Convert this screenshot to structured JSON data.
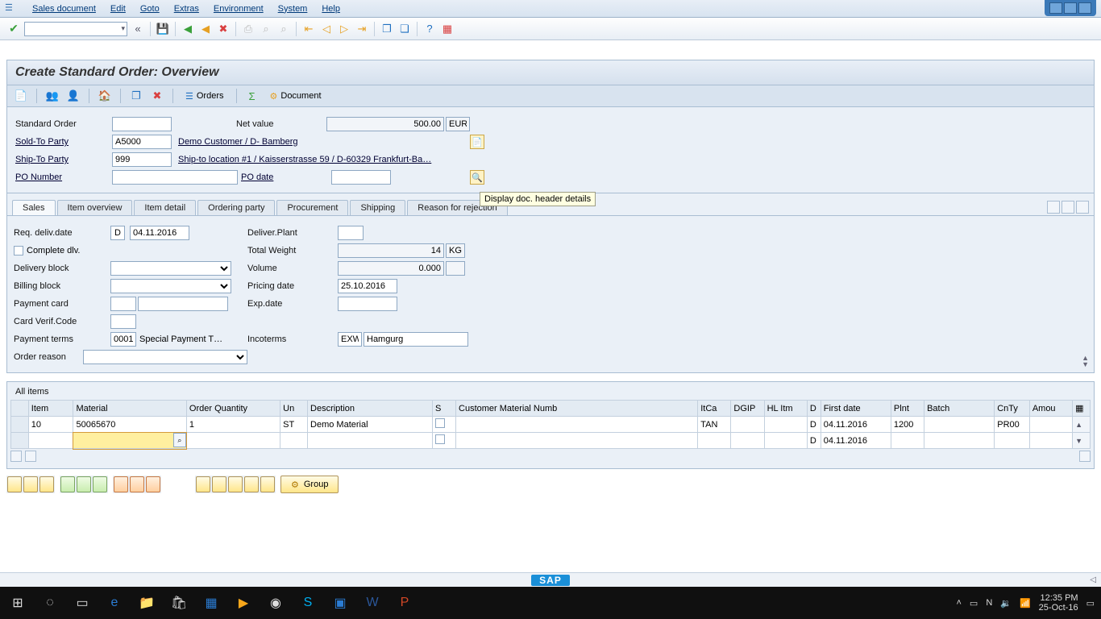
{
  "menubar": {
    "items": [
      "Sales document",
      "Edit",
      "Goto",
      "Extras",
      "Environment",
      "System",
      "Help"
    ]
  },
  "page_title": "Create Standard Order: Overview",
  "app_toolbar": {
    "orders_label": "Orders",
    "document_label": "Document"
  },
  "header": {
    "standard_order_label": "Standard Order",
    "standard_order": "",
    "net_value_label": "Net value",
    "net_value": "500.00",
    "currency": "EUR",
    "sold_to_label": "Sold-To Party",
    "sold_to": "A5000",
    "sold_to_desc": "Demo Customer / D- Bamberg",
    "ship_to_label": "Ship-To Party",
    "ship_to": "999",
    "ship_to_desc": "Ship-to location #1 / Kaisserstrasse 59 / D-60329 Frankfurt-Ba…",
    "po_number_label": "PO Number",
    "po_number": "",
    "po_date_label": "PO date",
    "po_date": "",
    "header_details_tooltip": "Display doc. header details"
  },
  "tabs": [
    "Sales",
    "Item overview",
    "Item detail",
    "Ordering party",
    "Procurement",
    "Shipping",
    "Reason for rejection"
  ],
  "active_tab": 0,
  "sales": {
    "req_deliv_date_label": "Req. deliv.date",
    "req_deliv_date_type": "D",
    "req_deliv_date": "04.11.2016",
    "deliver_plant_label": "Deliver.Plant",
    "deliver_plant": "",
    "complete_dlv_label": "Complete dlv.",
    "complete_dlv": false,
    "total_weight_label": "Total Weight",
    "total_weight": "14",
    "weight_unit": "KG",
    "delivery_block_label": "Delivery block",
    "delivery_block": "",
    "volume_label": "Volume",
    "volume": "0.000",
    "volume_unit": "",
    "billing_block_label": "Billing block",
    "billing_block": "",
    "pricing_date_label": "Pricing date",
    "pricing_date": "25.10.2016",
    "payment_card_label": "Payment card",
    "payment_card_type": "",
    "payment_card": "",
    "exp_date_label": "Exp.date",
    "exp_date": "",
    "card_verif_label": "Card Verif.Code",
    "card_verif": "",
    "payment_terms_label": "Payment terms",
    "payment_terms_code": "0001",
    "payment_terms_text": "Special Payment T…",
    "incoterms_label": "Incoterms",
    "incoterms_code": "EXW",
    "incoterms_text": "Hamgurg",
    "order_reason_label": "Order reason",
    "order_reason": ""
  },
  "grid": {
    "title": "All items",
    "columns": [
      "Item",
      "Material",
      "Order Quantity",
      "Un",
      "Description",
      "S",
      "Customer Material Numb",
      "ItCa",
      "DGIP",
      "HL Itm",
      "D",
      "First date",
      "Plnt",
      "Batch",
      "CnTy",
      "Amou"
    ],
    "rows": [
      {
        "item": "10",
        "material": "50065670",
        "qty": "1",
        "un": "ST",
        "desc": "Demo Material",
        "s": "",
        "custmat": "",
        "itca": "TAN",
        "dgip": "",
        "hlitm": "",
        "d": "D",
        "first_date": "04.11.2016",
        "plnt": "1200",
        "batch": "",
        "cnty": "PR00",
        "amount": ""
      },
      {
        "item": "",
        "material": "",
        "qty": "",
        "un": "",
        "desc": "",
        "s": "",
        "custmat": "",
        "itca": "",
        "dgip": "",
        "hlitm": "",
        "d": "D",
        "first_date": "04.11.2016",
        "plnt": "",
        "batch": "",
        "cnty": "",
        "amount": ""
      }
    ]
  },
  "group_button": "Group",
  "taskbar": {
    "time": "12:35 PM",
    "date": "25-Oct-16"
  }
}
